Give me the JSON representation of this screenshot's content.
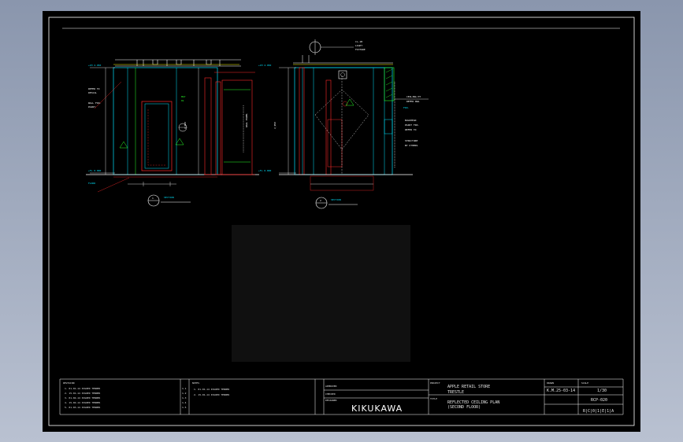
{
  "title_block": {
    "brand": "KIKUKAWA",
    "project": "APPLE RETAIL STORE",
    "project_sub": "TRESTLE",
    "drawing_title_1": "REFLECTED CEILING PLAN",
    "drawing_title_2": "(SECOND FLOOR)",
    "date": "25-03-14",
    "scale": "1/30",
    "drawing_no": "RCP-020",
    "code": "R|C|0|1|E|1|A",
    "drawn_label": "DRAWN",
    "drawn_by": "K.M.",
    "revisions": [
      "1. 01-01-14 ISSUED TENDER",
      "2. 15-01-14 ISSUED TENDER",
      "3. 01-02-14 ISSUED TENDER",
      "4. 15-02-14 ISSUED TENDER",
      "5. 01-03-14 ISSUED TENDER"
    ],
    "revision_marks": [
      "1.1",
      "1.2",
      "1.3",
      "1.4",
      "1.5"
    ],
    "notes": [
      "1. 01-01-14 ISSUED TENDER",
      "2. 15-01-14 ISSUED TENDER"
    ],
    "approvals": [
      "APPROVED",
      "CHECKED",
      "DESIGNED"
    ]
  },
  "sections": {
    "left_tag": "1",
    "right_tag": "2",
    "left_label": "SECTION",
    "right_label": "SECTION"
  },
  "colors": {
    "frame": "#ffffff",
    "cyan": "#00e5ff",
    "red": "#ff2a2a",
    "green": "#29ff29",
    "viewport": "#101010"
  }
}
